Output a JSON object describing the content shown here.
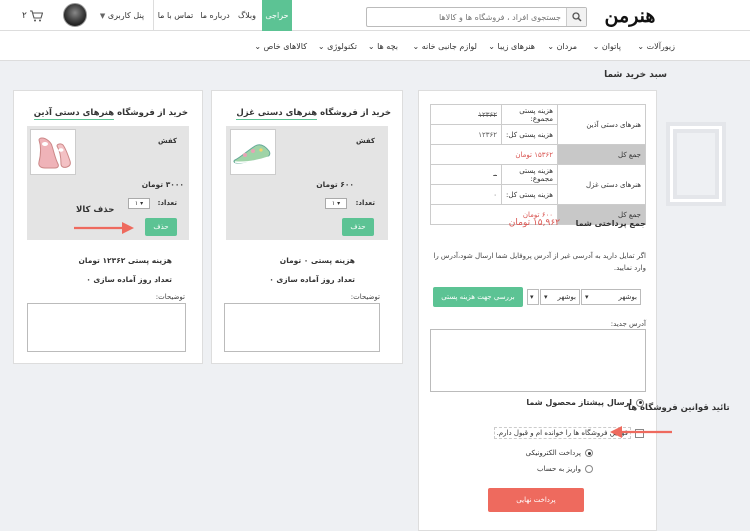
{
  "header": {
    "logo_text": "هنرمن",
    "search_placeholder": "جستجوی افراد ، فروشگاه ها و کالاها",
    "nav": {
      "auction": "حراجی",
      "blog": "وبلاگ",
      "about": "درباره ما",
      "contact": "تماس با ما"
    },
    "user_panel": "پنل کاربری",
    "cart_count": "۲"
  },
  "categories": [
    "زیورآلات",
    "پاتوان",
    "مردان",
    "هنرهای زیبا",
    "لوازم جانبی خانه",
    "بچه ها",
    "تکنولوژی",
    "کالاهای خاص"
  ],
  "page_title": "سبد خرید شما",
  "summary": {
    "stores": [
      {
        "name": "هنرهای دستی آذین",
        "ship_label": "هزینه پستی مجموع:",
        "ship_value": "۱۲۳۶۲",
        "total_ship_label": "هزینه پستی کل:",
        "total_ship_value": "۱۲۳۶۲",
        "sum_label": "جمع کل",
        "sum_value": "۱۵۳۶۲ تومان"
      },
      {
        "name": "هنرهای دستی غزل",
        "ship_label": "هزینه پستی مجموع:",
        "ship_value": "۰",
        "total_ship_label": "هزینه پستی کل:",
        "total_ship_value": "۰",
        "sum_label": "جمع کل",
        "sum_value": "۶۰۰ تومان"
      }
    ],
    "grand_label": "جمع پرداختی شما",
    "grand_value": "۱۵,۹۶۲ تومان"
  },
  "address": {
    "note": "اگر تمایل دارید به آدرسی غیر از آدرس پروفایل شما ارسال شود،آدرس را وارد نمایید.",
    "province": "بوشهر",
    "city": "بوشهر",
    "calc_button": "بررسی جهت هزینه پستی",
    "new_label": "آدرس جدید:"
  },
  "shipping_option": "ارسال پیشتاز محصول شما",
  "terms_text": "قوانین فروشگاه ها را خوانده ام و قبول دارم.",
  "payment": {
    "online": "پرداخت الکترونیکی",
    "deposit": "واریز به حساب"
  },
  "final_button": "پرداخت نهایی",
  "vendors": [
    {
      "title_prefix": "خرید از فروشگاه",
      "name": "هنرهای دستی غزل",
      "item": "کفش",
      "price": "۶۰۰ تومان",
      "qty_label": "تعداد:",
      "qty": "۱",
      "delete": "حذف",
      "ship_cost": "هزینه پستی ۰ تومان",
      "prep_days": "تعداد روز آماده سازی ۰",
      "notes_label": "توضیحات:"
    },
    {
      "title_prefix": "خرید از فروشگاه",
      "name": "هنرهای دستی آذین",
      "item": "کفش",
      "price": "۳۰۰۰ تومان",
      "qty_label": "تعداد:",
      "qty": "۱",
      "delete": "حذف",
      "ship_cost": "هزینه پستی ۱۲۳۶۲ تومان",
      "prep_days": "تعداد روز آماده سازی ۰",
      "notes_label": "توضیحات:"
    }
  ],
  "annotations": {
    "delete_item": "حذف کالا",
    "confirm_terms": "تائید قوانین فروشگاه ها"
  },
  "colors": {
    "green": "#5cc394",
    "red": "#ee6a5e",
    "price_red": "#d9534f",
    "arrow": "#ee6a5e"
  }
}
